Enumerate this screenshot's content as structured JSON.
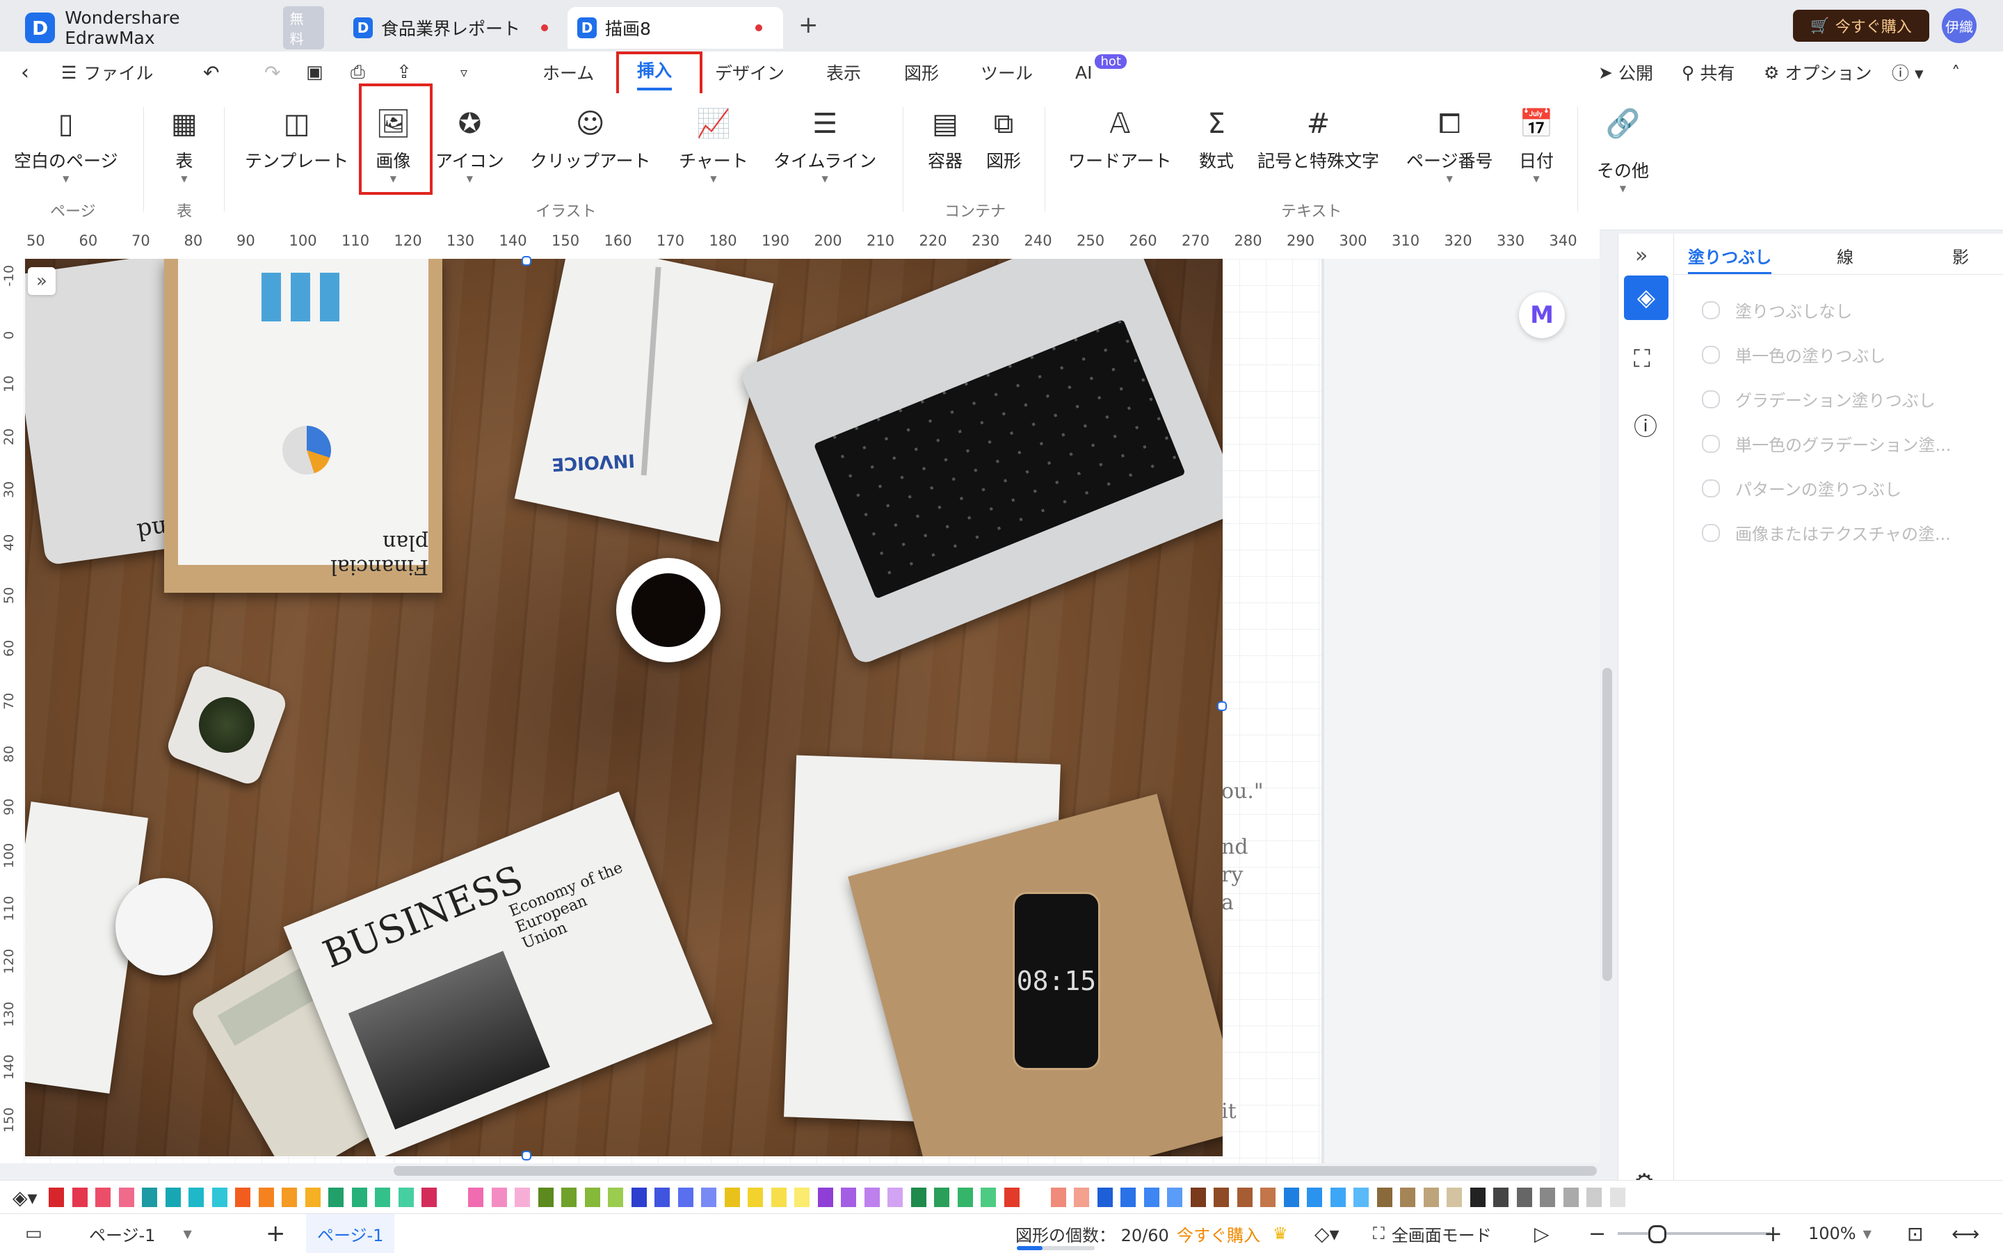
{
  "tabs": [
    {
      "label": "Wondershare EdrawMax",
      "badge": "無料"
    },
    {
      "label": "食品業界レポート",
      "modified": true
    },
    {
      "label": "描画8",
      "modified": true,
      "active": true
    }
  ],
  "top_right": {
    "buy_label": "今すぐ購入",
    "user": "伊織"
  },
  "menu": {
    "file": "ファイル",
    "items": [
      "ホーム",
      "挿入",
      "デザイン",
      "表示",
      "図形",
      "ツール",
      "AI"
    ],
    "ai_badge": "hot",
    "right": {
      "publish": "公開",
      "share": "共有",
      "options": "オプション"
    }
  },
  "ribbon": {
    "buttons": {
      "blank_page": "空白のページ",
      "table": "表",
      "template": "テンプレート",
      "image": "画像",
      "icon": "アイコン",
      "clipart": "クリップアート",
      "chart": "チャート",
      "timeline": "タイムライン",
      "container": "容器",
      "shape": "図形",
      "wordart": "ワードアート",
      "formula": "数式",
      "symbols": "記号と特殊文字",
      "page_number": "ページ番号",
      "date": "日付",
      "other": "その他"
    },
    "groups": {
      "page": "ページ",
      "table": "表",
      "illust": "イラスト",
      "container": "コンテナ",
      "text": "テキスト"
    }
  },
  "ruler_h": [
    "50",
    "60",
    "70",
    "80",
    "90",
    "100",
    "110",
    "120",
    "130",
    "140",
    "150",
    "160",
    "170",
    "180",
    "190",
    "200",
    "210",
    "220",
    "230",
    "240",
    "250",
    "260",
    "270",
    "280",
    "290",
    "300",
    "310",
    "320",
    "330",
    "340"
  ],
  "ruler_v": [
    "-10",
    "0",
    "10",
    "20",
    "30",
    "40",
    "50",
    "60",
    "70",
    "80",
    "90",
    "100",
    "110",
    "120",
    "130",
    "140",
    "150"
  ],
  "photo": {
    "tax_form": "Tax Refund Form",
    "financial_plan": "Financial plan",
    "invoice": "INVOICE",
    "newspaper_title": "BUSINESS",
    "newspaper_sub": "Economy of the European Union",
    "phone_time": "08:15"
  },
  "side_text": [
    "ou.\"",
    "nd",
    "ry",
    "a",
    "it"
  ],
  "panel": {
    "tabs": [
      "塗りつぶし",
      "線",
      "影"
    ],
    "options": [
      "塗りつぶしなし",
      "単一色の塗りつぶし",
      "グラデーション塗りつぶし",
      "単一色のグラデーション塗...",
      "パターンの塗りつぶし",
      "画像またはテクスチャの塗..."
    ]
  },
  "palette": [
    "#d7262b",
    "#e4364d",
    "#ec4e6a",
    "#f06a8c",
    "#1d9aa3",
    "#17a7b3",
    "#1fb8c8",
    "#2fc6d8",
    "#f25d1f",
    "#f6821f",
    "#f59a23",
    "#f5b024",
    "#21a06a",
    "#27b07a",
    "#33c08a",
    "#46cfa0",
    "#d42c5a",
    "#ffffff",
    "#f06bb0",
    "#f48cc4",
    "#f7aed6",
    "#5c8a1e",
    "#6fa12b",
    "#86b83a",
    "#9ccc4f",
    "#2c3fcf",
    "#3f55e0",
    "#5a6ff0",
    "#7a8af5",
    "#e8c21a",
    "#f2d22d",
    "#f7df4c",
    "#fbeb6e",
    "#8f3fd6",
    "#a45ee3",
    "#bd80ec",
    "#d3a3f3",
    "#1f8a4c",
    "#2a9f5a",
    "#35b56a",
    "#4ecb82",
    "#e23b2a",
    "#ffffff",
    "#f08a7a",
    "#f3a08f",
    "#1d5fd6",
    "#2a72e8",
    "#3d86f4",
    "#5a9cf8",
    "#7a3a1c",
    "#8f4a26",
    "#a65d34",
    "#c27649",
    "#1f7fe0",
    "#2a93ef",
    "#3da7f7",
    "#5abaf9",
    "#8a6a3a",
    "#a58457",
    "#bda47a",
    "#d3c3a0",
    "#222222",
    "#444444",
    "#666666",
    "#888888",
    "#aaaaaa",
    "#cccccc",
    "#e2e2e2"
  ],
  "status": {
    "page_select": "ページ-1",
    "page_tab": "ページ-1",
    "shape_count": "図形の個数： 20/60",
    "buy": "今すぐ購入",
    "fullscreen": "全画面モード",
    "zoom": "100%"
  }
}
